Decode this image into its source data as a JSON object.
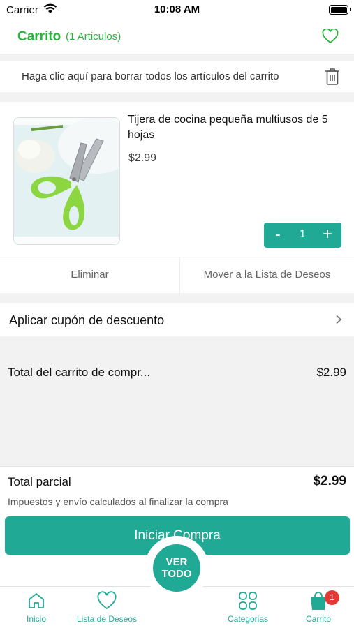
{
  "status_bar": {
    "carrier": "Carrier",
    "time": "10:08 AM"
  },
  "header": {
    "title": "Carrito",
    "count": "(1 Articulos)"
  },
  "clear_bar": {
    "text": "Haga clic aquí para borrar todos los artículos del carrito"
  },
  "item": {
    "name": "Tijera de cocina pequeña multiusos de 5 hojas",
    "price": "$2.99",
    "quantity": "1",
    "minus": "-",
    "plus": "+",
    "remove_label": "Eliminar",
    "move_label": "Mover a la Lista de Deseos"
  },
  "coupon": {
    "label": "Aplicar cupón de descuento"
  },
  "cart_total": {
    "label": "Total del carrito de compr...",
    "value": "$2.99"
  },
  "subtotal": {
    "label": "Total parcial",
    "value": "$2.99",
    "note": "Impuestos y envío calculados al finalizar la compra",
    "button": "Iniciar Compra"
  },
  "fab": {
    "line1": "VER",
    "line2": "TODO"
  },
  "tabbar": {
    "home": "Inicio",
    "wishlist": "Lista de Deseos",
    "categories": "Categorias",
    "cart": "Carrito",
    "cart_badge": "1"
  },
  "colors": {
    "accent": "#20a995",
    "header_green": "#2bb33d",
    "badge": "#e53935"
  },
  "icons": [
    "wifi-icon",
    "battery-icon",
    "heart-icon",
    "trash-icon",
    "chevron-right-icon",
    "home-icon",
    "heart-outline-icon",
    "grid-icon",
    "shopping-bag-icon"
  ]
}
